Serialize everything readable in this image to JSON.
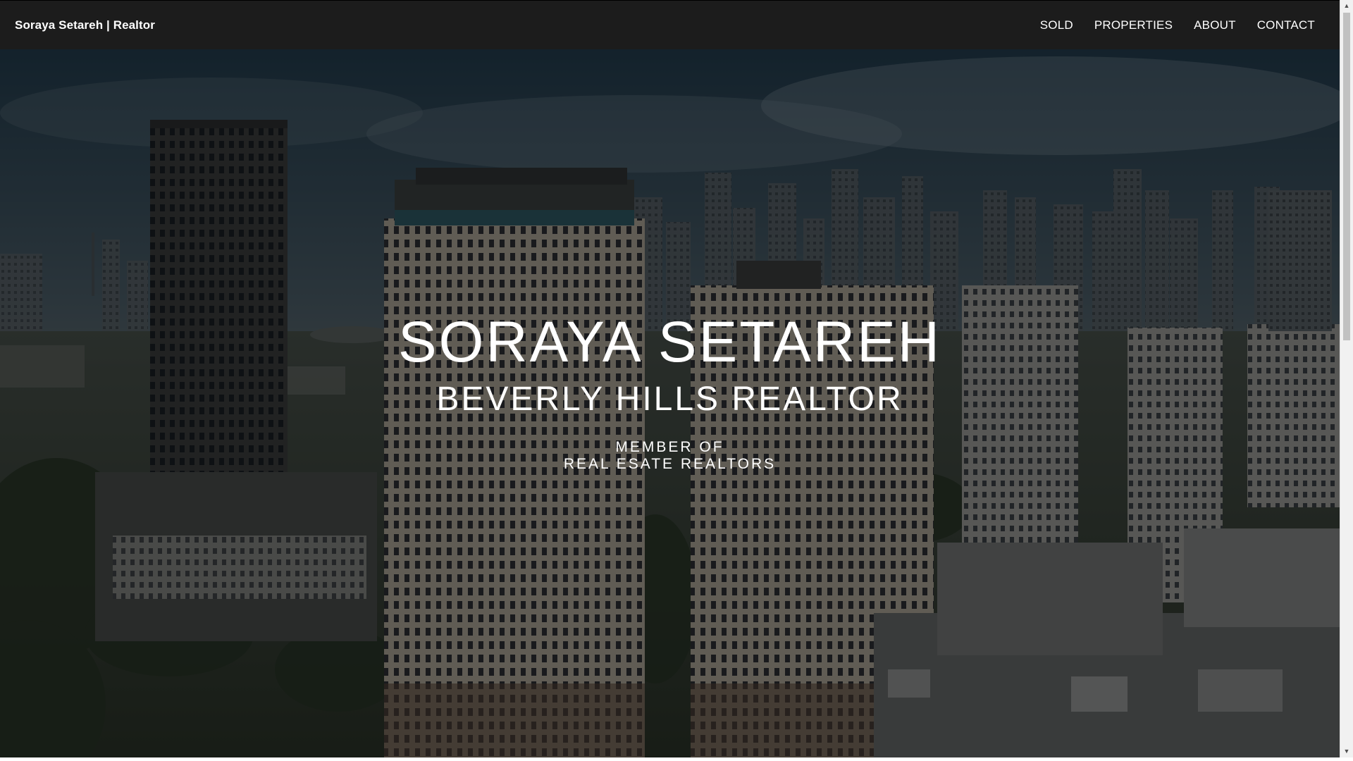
{
  "nav": {
    "brand": "Soraya Setareh | Realtor",
    "links": [
      "SOLD",
      "PROPERTIES",
      "ABOUT",
      "CONTACT"
    ]
  },
  "hero": {
    "title": "SORAYA SETAREH",
    "subtitle": "BEVERLY HILLS REALTOR",
    "member_line1": "MEMBER OF",
    "member_line2": "REAL ESATE REALTORS"
  },
  "colors": {
    "navbar": "#1c1c1c",
    "text": "#ffffff",
    "sky": "#2a3a46"
  },
  "scrollbar": {
    "up_icon": "triangle-up",
    "down_icon": "triangle-down"
  }
}
